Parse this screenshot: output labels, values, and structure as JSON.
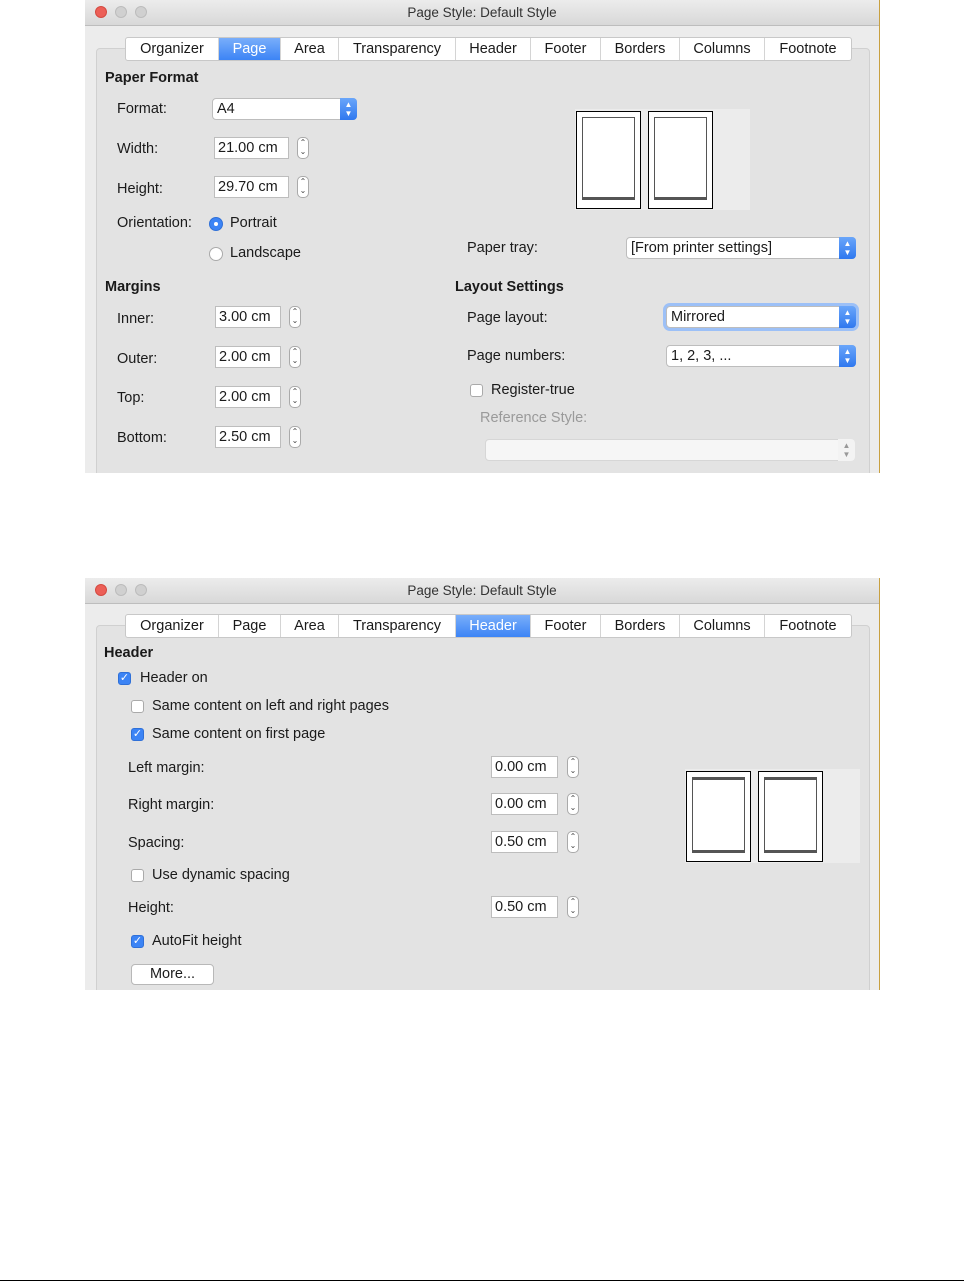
{
  "dialog_title": "Page Style: Default Style",
  "tabs": [
    "Organizer",
    "Page",
    "Area",
    "Transparency",
    "Header",
    "Footer",
    "Borders",
    "Columns",
    "Footnote"
  ],
  "accent": "#3c84f5",
  "page_tab": {
    "active_tab": "Page",
    "paper_format": {
      "heading": "Paper Format",
      "format_label": "Format:",
      "format_value": "A4",
      "width_label": "Width:",
      "width_value": "21.00 cm",
      "height_label": "Height:",
      "height_value": "29.70 cm",
      "orientation_label": "Orientation:",
      "portrait": "Portrait",
      "landscape": "Landscape",
      "selected_orientation": "Portrait"
    },
    "margins": {
      "heading": "Margins",
      "inner_label": "Inner:",
      "inner_value": "3.00 cm",
      "outer_label": "Outer:",
      "outer_value": "2.00 cm",
      "top_label": "Top:",
      "top_value": "2.00 cm",
      "bottom_label": "Bottom:",
      "bottom_value": "2.50 cm"
    },
    "paper_tray_label": "Paper tray:",
    "paper_tray_value": "[From printer settings]",
    "layout": {
      "heading": "Layout Settings",
      "page_layout_label": "Page layout:",
      "page_layout_value": "Mirrored",
      "page_numbers_label": "Page numbers:",
      "page_numbers_value": "1, 2, 3, ...",
      "register_true": "Register-true",
      "register_true_checked": false,
      "reference_style_label": "Reference Style:",
      "reference_style_value": ""
    }
  },
  "header_tab": {
    "active_tab": "Header",
    "heading": "Header",
    "header_on": "Header on",
    "header_on_checked": true,
    "same_lr": "Same content on left and right pages",
    "same_lr_checked": false,
    "same_first": "Same content on first page",
    "same_first_checked": true,
    "left_margin_label": "Left margin:",
    "left_margin_value": "0.00 cm",
    "right_margin_label": "Right margin:",
    "right_margin_value": "0.00 cm",
    "spacing_label": "Spacing:",
    "spacing_value": "0.50 cm",
    "dynamic_spacing": "Use dynamic spacing",
    "dynamic_spacing_checked": false,
    "height_label": "Height:",
    "height_value": "0.50 cm",
    "autofit": "AutoFit height",
    "autofit_checked": true,
    "more_button": "More..."
  }
}
